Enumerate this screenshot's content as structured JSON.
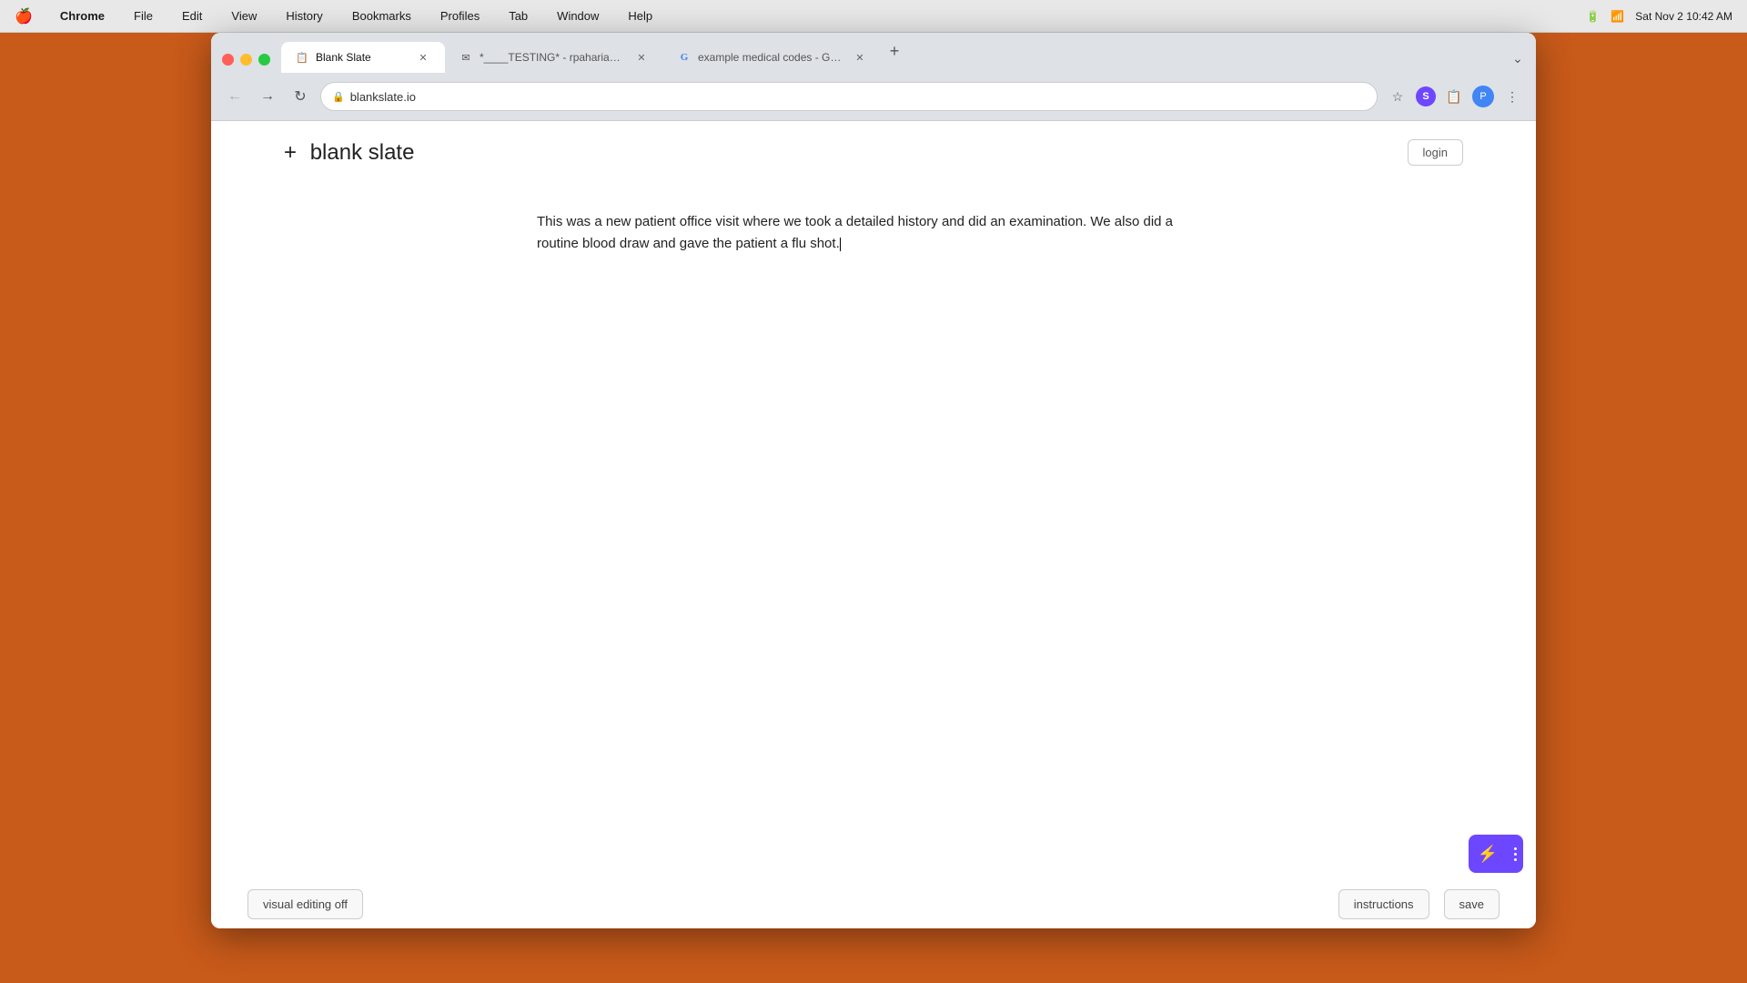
{
  "menubar": {
    "apple": "🍎",
    "items": [
      "Chrome",
      "File",
      "Edit",
      "View",
      "History",
      "Bookmarks",
      "Profiles",
      "Tab",
      "Window",
      "Help"
    ],
    "right": {
      "datetime": "Sat Nov 2  10:42 AM",
      "battery": "100%"
    }
  },
  "browser": {
    "tabs": [
      {
        "id": "tab1",
        "favicon": "📋",
        "title": "Blank Slate",
        "active": true,
        "closable": true
      },
      {
        "id": "tab2",
        "favicon": "✉",
        "title": "*____TESTING* - rpaharia@...",
        "active": false,
        "closable": true
      },
      {
        "id": "tab3",
        "favicon": "G",
        "title": "example medical codes - Go...",
        "active": false,
        "closable": true
      }
    ],
    "url": "blankslate.io",
    "new_tab_label": "+",
    "expand_label": "⌄"
  },
  "app": {
    "logo_plus": "+",
    "logo_name": "blank slate",
    "login_label": "login"
  },
  "editor": {
    "text": "This was a new patient office visit where we took a detailed history and did an examination. We also did a routine blood draw and gave the patient a flu shot."
  },
  "bottom_bar": {
    "visual_editing_label": "visual editing off",
    "instructions_label": "instructions",
    "save_label": "save"
  },
  "lightning": {
    "icon": "⚡"
  }
}
